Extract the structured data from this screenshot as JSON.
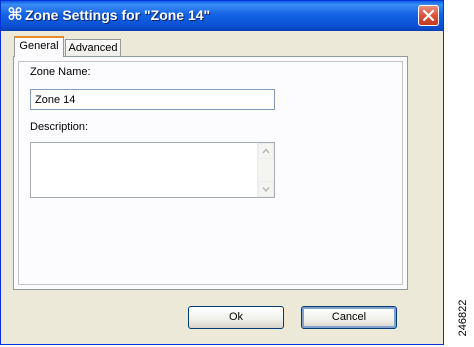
{
  "window": {
    "title": "Zone Settings for \"Zone 14\""
  },
  "tabs": [
    {
      "label": "General",
      "active": true
    },
    {
      "label": "Advanced",
      "active": false
    }
  ],
  "form": {
    "zone_name_label": "Zone Name:",
    "zone_name_value": "Zone 14",
    "description_label": "Description:",
    "description_value": ""
  },
  "buttons": {
    "ok": "Ok",
    "cancel": "Cancel"
  },
  "icons": {
    "app": "command-icon",
    "close": "close-icon",
    "scroll_up": "arrow-up-icon",
    "scroll_down": "arrow-down-icon"
  },
  "colors": {
    "titlebar": "#0a4fd2",
    "close_button": "#d7553a",
    "window_bg": "#ece9d8",
    "active_tab_accent": "#e68b2c"
  },
  "figure_number": "246822"
}
